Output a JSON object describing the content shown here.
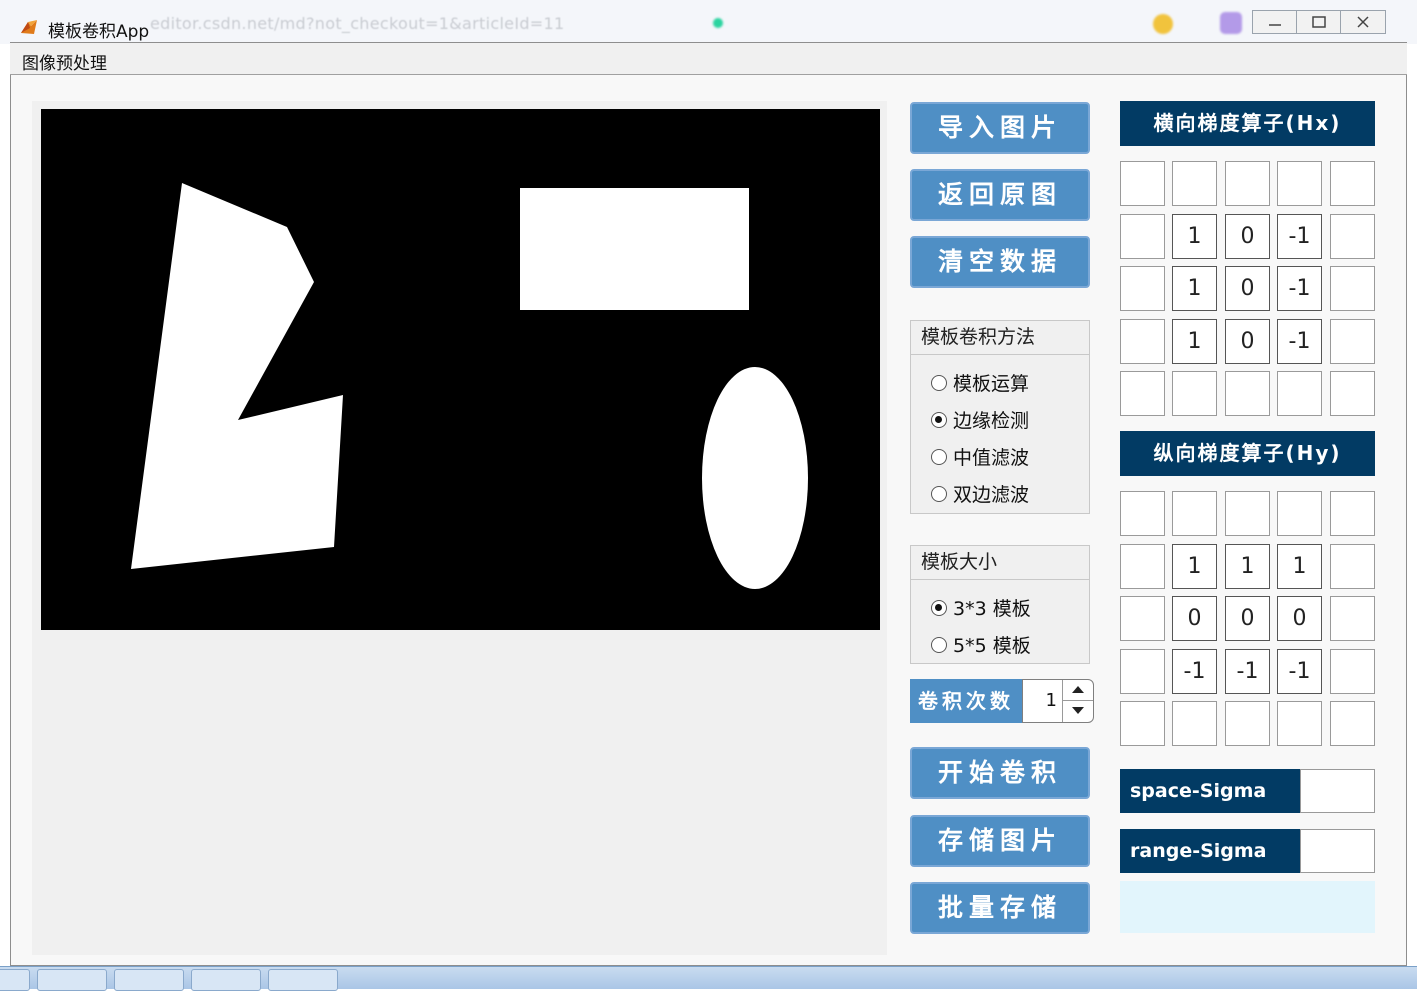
{
  "window": {
    "title": "模板卷积App"
  },
  "background_url": "editor.csdn.net/md?not_checkout=1&articleId=11",
  "menu": {
    "items": [
      "图像预处理"
    ]
  },
  "buttons": {
    "import": "导入图片",
    "restore": "返回原图",
    "clear": "清空数据",
    "start": "开始卷积",
    "save": "存储图片",
    "batch_save": "批量存储"
  },
  "method_panel": {
    "title": "模板卷积方法",
    "options": [
      "模板运算",
      "边缘检测",
      "中值滤波",
      "双边滤波"
    ],
    "selected": "边缘检测"
  },
  "size_panel": {
    "title": "模板大小",
    "options": [
      "3*3 模板",
      "5*5 模板"
    ],
    "selected": "3*3 模板"
  },
  "iterations": {
    "label": "卷积次数",
    "value": "1"
  },
  "hx": {
    "title": "横向梯度算子(Hx)",
    "rows": [
      [
        "",
        "",
        "",
        "",
        ""
      ],
      [
        "",
        "1",
        "0",
        "-1",
        ""
      ],
      [
        "",
        "1",
        "0",
        "-1",
        ""
      ],
      [
        "",
        "1",
        "0",
        "-1",
        ""
      ],
      [
        "",
        "",
        "",
        "",
        ""
      ]
    ]
  },
  "hy": {
    "title": "纵向梯度算子(Hy)",
    "rows": [
      [
        "",
        "",
        "",
        "",
        ""
      ],
      [
        "",
        "1",
        "1",
        "1",
        ""
      ],
      [
        "",
        "0",
        "0",
        "0",
        ""
      ],
      [
        "",
        "-1",
        "-1",
        "-1",
        ""
      ],
      [
        "",
        "",
        "",
        "",
        ""
      ]
    ]
  },
  "sigma": {
    "space_label": "space-Sigma",
    "space_value": "",
    "range_label": "range-Sigma",
    "range_value": ""
  },
  "colors": {
    "button_blue": "#4f8fc5",
    "header_navy": "#023b64",
    "panel_gray": "#f0f0f0",
    "info_cyan": "#e2f5fc"
  }
}
